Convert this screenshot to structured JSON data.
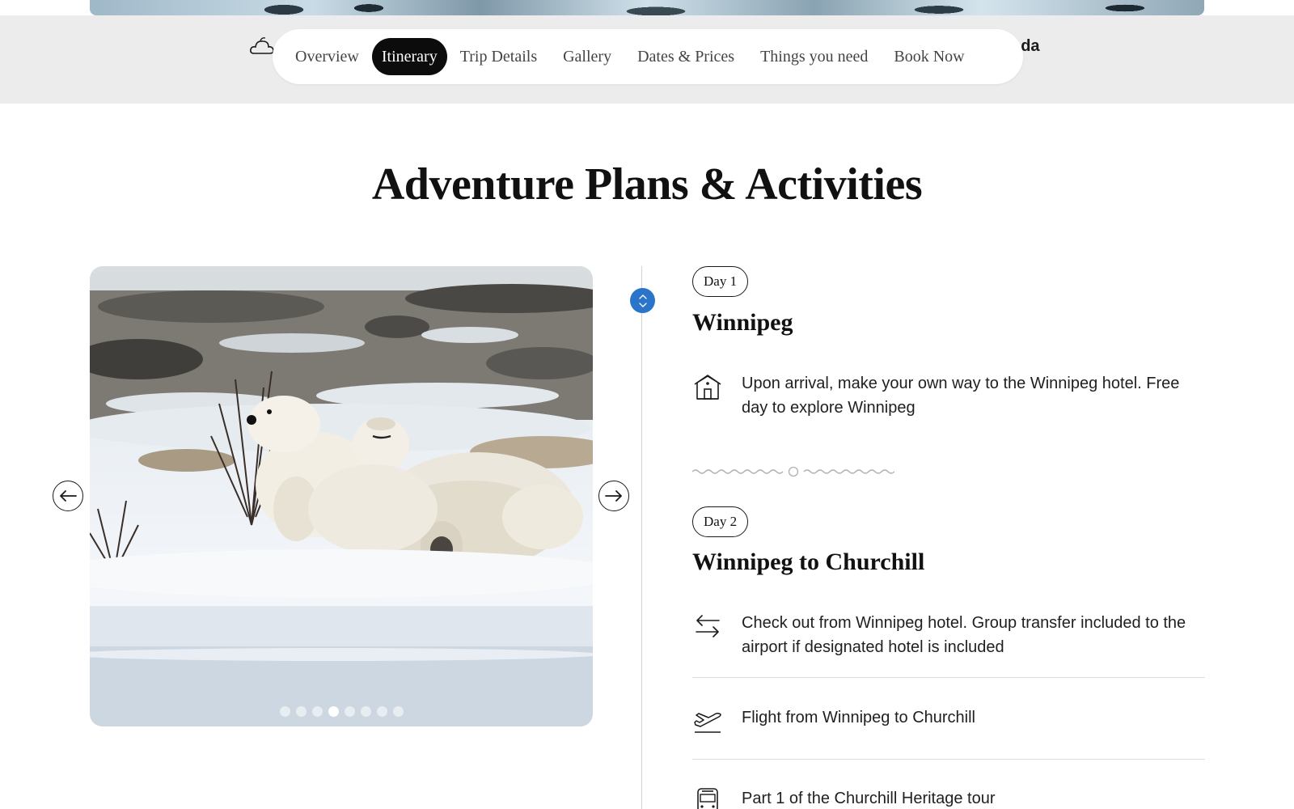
{
  "nav": {
    "behind_text": "nda",
    "items": [
      {
        "label": "Overview",
        "active": false
      },
      {
        "label": "Itinerary",
        "active": true
      },
      {
        "label": "Trip Details",
        "active": false
      },
      {
        "label": "Gallery",
        "active": false
      },
      {
        "label": "Dates & Prices",
        "active": false
      },
      {
        "label": "Things you need",
        "active": false
      },
      {
        "label": "Book Now",
        "active": false
      }
    ]
  },
  "section": {
    "title": "Adventure Plans & Activities"
  },
  "carousel": {
    "image_subject": "polar-bears-in-snow",
    "slide_count": 8,
    "active_slide": 4
  },
  "days": [
    {
      "badge": "Day 1",
      "title": "Winnipeg",
      "activities": [
        {
          "icon": "hotel-icon",
          "text": "Upon arrival, make your own way to the Winnipeg hotel. Free day to explore Winnipeg"
        }
      ]
    },
    {
      "badge": "Day 2",
      "title": "Winnipeg to Churchill",
      "activities": [
        {
          "icon": "transfer-arrows-icon",
          "text": "Check out from Winnipeg hotel. Group transfer included to the airport if designated hotel is included"
        },
        {
          "icon": "plane-takeoff-icon",
          "text": "Flight from Winnipeg to Churchill"
        },
        {
          "icon": "bus-icon",
          "text": "Part 1 of the Churchill Heritage tour"
        }
      ]
    }
  ],
  "colors": {
    "nav_band": "#ececec",
    "active_pill": "#0c0c0c",
    "timeline_knob": "#2a74c9"
  }
}
